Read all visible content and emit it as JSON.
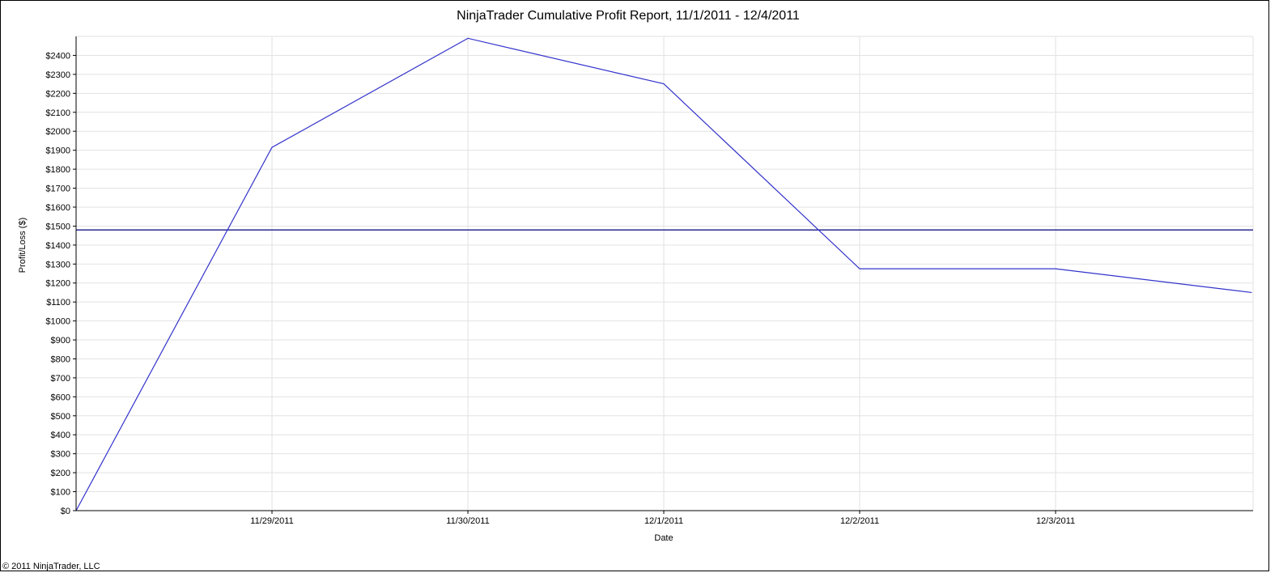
{
  "chart_data": {
    "type": "line",
    "title": "NinjaTrader Cumulative Profit Report, 11/1/2011 - 12/4/2011",
    "xlabel": "Date",
    "ylabel": "Profit/Loss ($)",
    "x_tick_labels": [
      "11/29/2011",
      "11/30/2011",
      "12/1/2011",
      "12/2/2011",
      "12/3/2011"
    ],
    "y_tick_labels": [
      "$0",
      "$100",
      "$200",
      "$300",
      "$400",
      "$500",
      "$600",
      "$700",
      "$800",
      "$900",
      "$1000",
      "$1100",
      "$1200",
      "$1300",
      "$1400",
      "$1500",
      "$1600",
      "$1700",
      "$1800",
      "$1900",
      "$2000",
      "$2100",
      "$2200",
      "$2300",
      "$2400"
    ],
    "ylim": [
      0,
      2500
    ],
    "y_tick_step": 100,
    "grid": true,
    "series": [
      {
        "color": "#3333cc",
        "points": [
          {
            "x": "11/28/2011",
            "y": 0
          },
          {
            "x": "11/29/2011",
            "y": 1915
          },
          {
            "x": "11/30/2011",
            "y": 2490
          },
          {
            "x": "12/1/2011",
            "y": 2250
          },
          {
            "x": "12/2/2011",
            "y": 1275
          },
          {
            "x": "12/3/2011",
            "y": 1275
          },
          {
            "x": "12/4/2011",
            "y": 1150
          }
        ]
      }
    ],
    "reference_line": {
      "y": 1480,
      "color": "#000080"
    }
  },
  "footer": {
    "copyright": "© 2011 NinjaTrader, LLC"
  }
}
